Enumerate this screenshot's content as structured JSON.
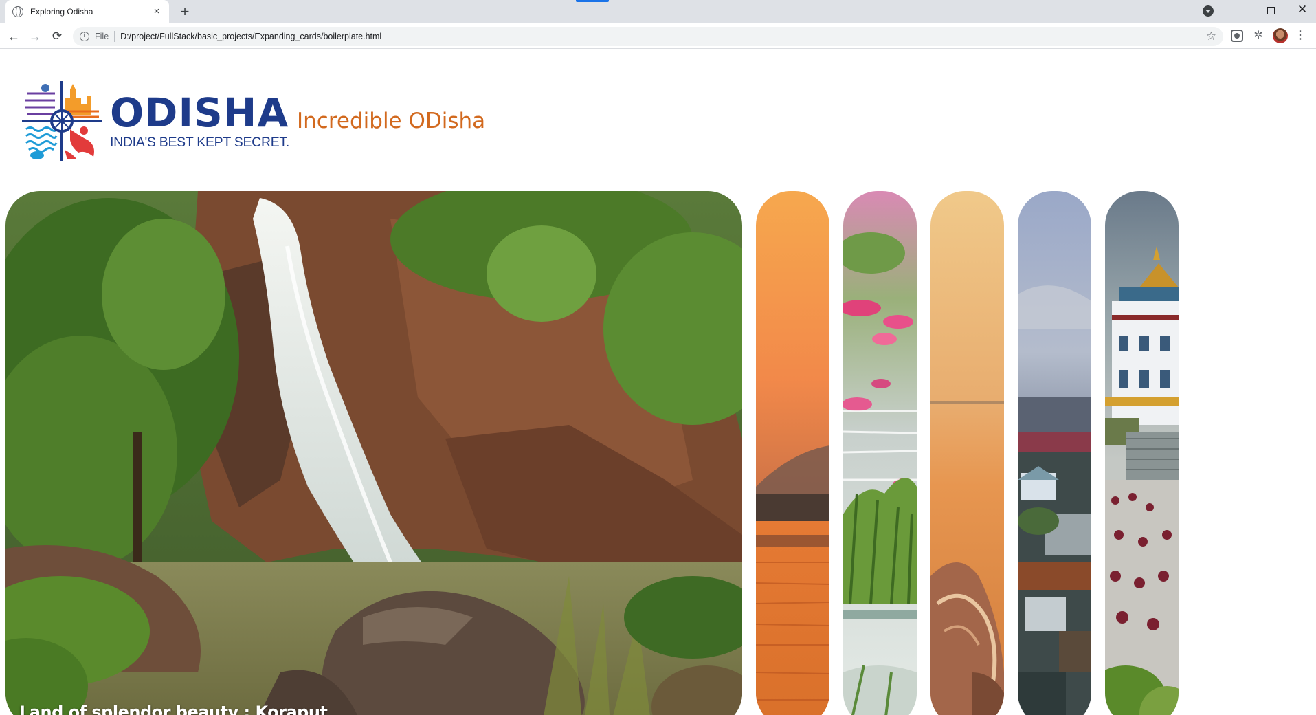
{
  "browser": {
    "tab_title": "Exploring Odisha",
    "tab_close": "×",
    "new_tab": "+",
    "scheme_label": "File",
    "url": "D:/project/FullStack/basic_projects/Expanding_cards/boilerplate.html",
    "nav": {
      "back": "←",
      "forward": "→",
      "reload": "⟳"
    },
    "star": "☆",
    "window": {
      "close": "✕"
    },
    "menu": "⋮",
    "puzzle": "✲",
    "info": "i"
  },
  "header": {
    "brand_name": "ODISHA",
    "brand_tagline": "INDIA'S BEST KEPT SECRET.",
    "headline": "Incredible ODisha"
  },
  "panels": [
    {
      "title": "Land of splendor beauty : Koraput",
      "active": true,
      "icon": "waterfall-photo"
    },
    {
      "title": "",
      "active": false,
      "icon": "sunset-lake-photo"
    },
    {
      "title": "",
      "active": false,
      "icon": "lotus-lake-photo"
    },
    {
      "title": "",
      "active": false,
      "icon": "conch-beach-photo"
    },
    {
      "title": "",
      "active": false,
      "icon": "town-view-photo"
    },
    {
      "title": "",
      "active": false,
      "icon": "monastery-photo"
    }
  ],
  "colors": {
    "brand_blue": "#1e3b8a",
    "headline_orange": "#d2691e",
    "chrome_bg": "#dee1e6"
  }
}
